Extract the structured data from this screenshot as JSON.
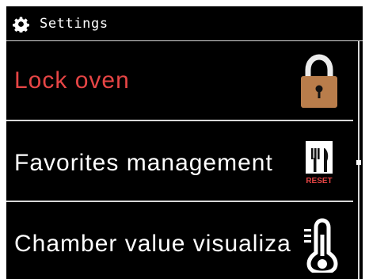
{
  "header": {
    "title": "Settings",
    "icon": "gear-icon"
  },
  "menu": {
    "items": [
      {
        "label": "Lock oven",
        "icon": "padlock-icon",
        "color": "#e64545"
      },
      {
        "label": "Favorites management",
        "icon": "favorites-reset-icon",
        "icon_badge": "RESET"
      },
      {
        "label": "Chamber value visualizat",
        "icon": "thermometer-icon"
      }
    ]
  },
  "theme": {
    "background": "#000000",
    "text": "#ffffff",
    "accent": "#e64545",
    "divider": "#d7d7d7",
    "lock_color": "#b97d4b"
  }
}
